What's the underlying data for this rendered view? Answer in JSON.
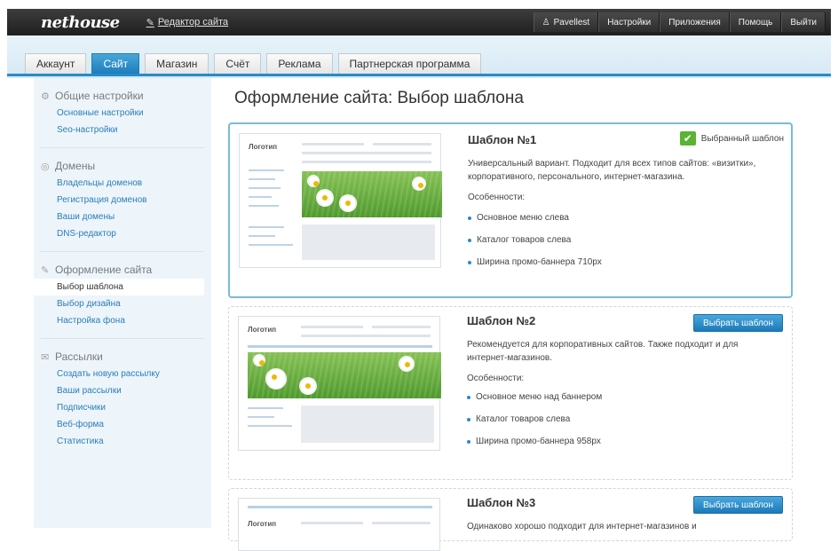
{
  "topbar": {
    "logo": "nethouse",
    "editor_link": "Редактор сайта",
    "nav": [
      "Pavellest",
      "Настройки",
      "Приложения",
      "Помощь",
      "Выйти"
    ]
  },
  "tabs": [
    {
      "label": "Аккаунт",
      "active": false
    },
    {
      "label": "Сайт",
      "active": true
    },
    {
      "label": "Магазин",
      "active": false
    },
    {
      "label": "Счёт",
      "active": false
    },
    {
      "label": "Реклама",
      "active": false
    },
    {
      "label": "Партнерская программа",
      "active": false
    }
  ],
  "sidebar": {
    "sections": [
      {
        "title": "Общие настройки",
        "icon": "gear-icon",
        "items": [
          {
            "label": "Основные настройки"
          },
          {
            "label": "Seo-настройки"
          }
        ]
      },
      {
        "title": "Домены",
        "icon": "globe-icon",
        "items": [
          {
            "label": "Владельцы доменов"
          },
          {
            "label": "Регистрация доменов"
          },
          {
            "label": "Ваши домены"
          },
          {
            "label": "DNS-редактор"
          }
        ]
      },
      {
        "title": "Оформление сайта",
        "icon": "pencil-icon",
        "items": [
          {
            "label": "Выбор шаблона",
            "active": true
          },
          {
            "label": "Выбор дизайна"
          },
          {
            "label": "Настройка фона"
          }
        ]
      },
      {
        "title": "Рассылки",
        "icon": "mail-icon",
        "items": [
          {
            "label": "Создать новую рассылку"
          },
          {
            "label": "Ваши рассылки"
          },
          {
            "label": "Подписчики"
          },
          {
            "label": "Веб-форма"
          },
          {
            "label": "Статистика"
          }
        ]
      }
    ]
  },
  "main": {
    "title": "Оформление сайта: Выбор шаблона",
    "thumb_logo": "Логотип",
    "features_label": "Особенности:",
    "selected_label": "Выбранный шаблон",
    "choose_label": "Выбрать шаблон",
    "templates": [
      {
        "title": "Шаблон №1",
        "desc": "Универсальный вариант. Подходит для всех типов сайтов: «визитки», корпоративного, персонального, интернет-магазина.",
        "features": [
          "Основное меню слева",
          "Каталог товаров слева",
          "Ширина промо-баннера 710px"
        ]
      },
      {
        "title": "Шаблон №2",
        "desc": "Рекомендуется для корпоративных сайтов. Также подходит и для интернет-магазинов.",
        "features": [
          "Основное меню над баннером",
          "Каталог товаров слева",
          "Ширина промо-баннера 958px"
        ]
      },
      {
        "title": "Шаблон №3",
        "desc": "Одинаково хорошо подходит для интернет-магазинов и"
      }
    ]
  },
  "colors": {
    "accent": "#1c7dbb",
    "selected_border": "#7bbad8",
    "check": "#5bb332"
  }
}
